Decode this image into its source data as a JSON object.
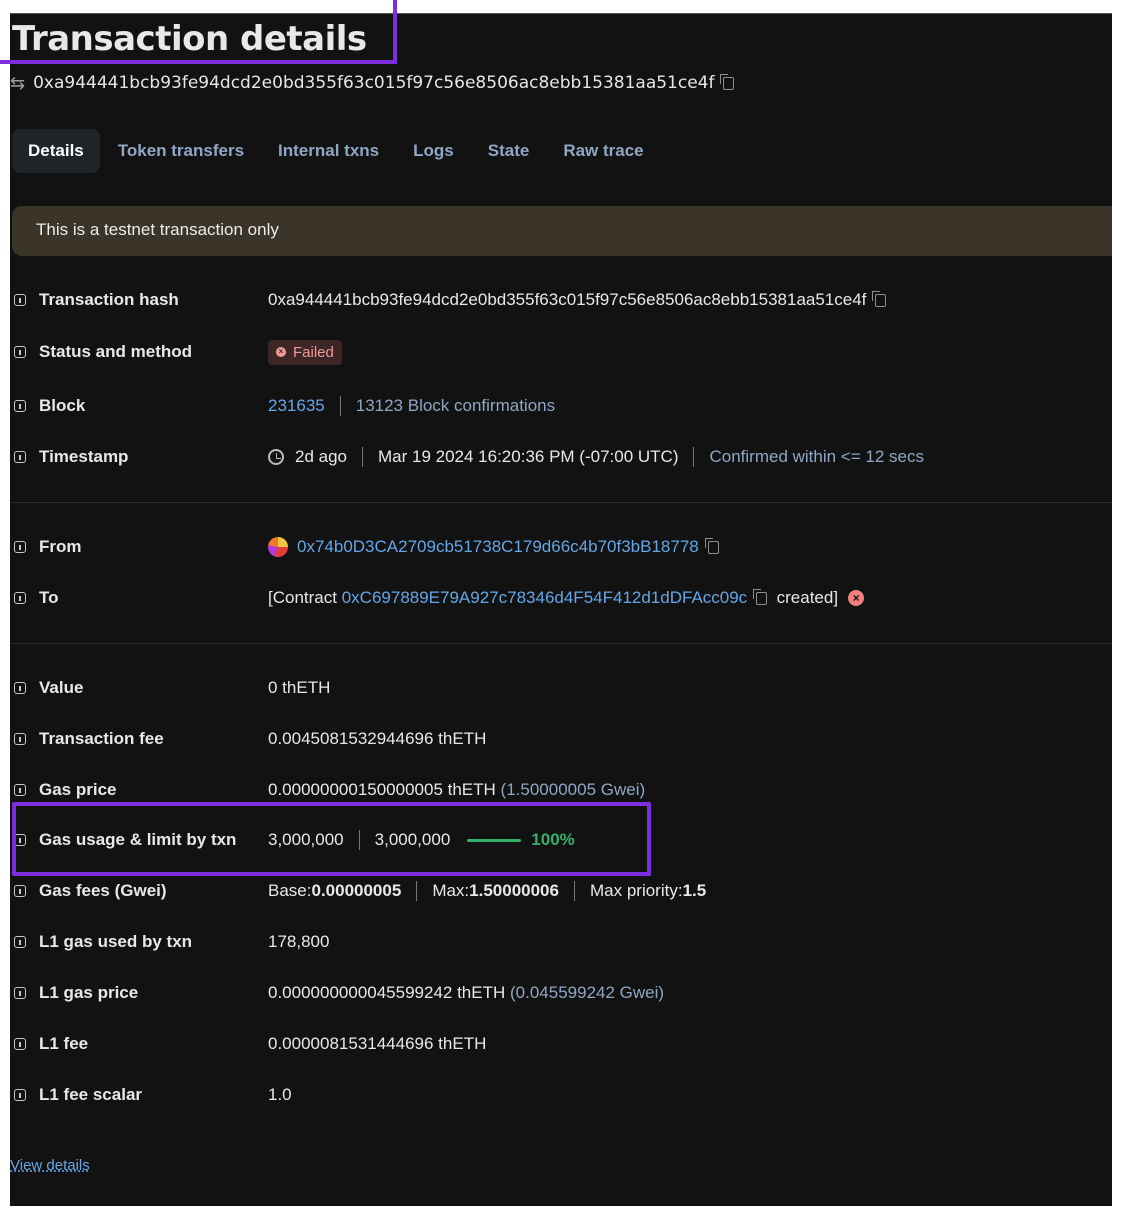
{
  "page": {
    "title": "Transaction details"
  },
  "hash_line": {
    "hash": "0xa944441bcb93fe94dcd2e0bd355f63c015f97c56e8506ac8ebb15381aa51ce4f"
  },
  "tabs": [
    {
      "label": "Details"
    },
    {
      "label": "Token transfers"
    },
    {
      "label": "Internal txns"
    },
    {
      "label": "Logs"
    },
    {
      "label": "State"
    },
    {
      "label": "Raw trace"
    }
  ],
  "alert": {
    "text": "This is a testnet transaction only"
  },
  "labels": {
    "tx_hash": "Transaction hash",
    "status": "Status and method",
    "block": "Block",
    "timestamp": "Timestamp",
    "from": "From",
    "to": "To",
    "value": "Value",
    "fee": "Transaction fee",
    "gas_price": "Gas price",
    "gas_usage": "Gas usage & limit by txn",
    "gas_fees": "Gas fees (Gwei)",
    "l1_gas_used": "L1 gas used by txn",
    "l1_gas_price": "L1 gas price",
    "l1_fee": "L1 fee",
    "l1_fee_scalar": "L1 fee scalar"
  },
  "values": {
    "tx_hash": "0xa944441bcb93fe94dcd2e0bd355f63c015f97c56e8506ac8ebb15381aa51ce4f",
    "status": "Failed",
    "block_number": "231635",
    "block_confirmations": "13123 Block confirmations",
    "time_ago": "2d ago",
    "time_full": "Mar 19 2024 16:20:36 PM (-07:00 UTC)",
    "confirmed_within": "Confirmed within <= 12 secs",
    "from_address": "0x74b0D3CA2709cb51738C179d66c4b70f3bB18778",
    "to_prefix": "[Contract",
    "to_address": "0xC697889E79A927c78346d4F54F412d1dDFAcc09c",
    "to_suffix": "created]",
    "value": "0 thETH",
    "fee": "0.0045081532944696 thETH",
    "gas_price_eth": "0.00000000150000005 thETH",
    "gas_price_gwei": "(1.50000005 Gwei)",
    "gas_used": "3,000,000",
    "gas_limit": "3,000,000",
    "gas_pct": "100%",
    "gas_fee_base_label": "Base: ",
    "gas_fee_base": "0.00000005",
    "gas_fee_max_label": "Max: ",
    "gas_fee_max": "1.50000006",
    "gas_fee_priority_label": "Max priority: ",
    "gas_fee_priority": "1.5",
    "l1_gas_used": "178,800",
    "l1_gas_price_eth": "0.000000000045599242 thETH",
    "l1_gas_price_gwei": "(0.045599242 Gwei)",
    "l1_fee": "0.0000081531444696 thETH",
    "l1_fee_scalar": "1.0"
  },
  "footer": {
    "view_details": "View details"
  },
  "colors": {
    "accent_highlight": "#7c2fe0",
    "link": "#63a7e8",
    "success": "#35b06b",
    "failed": "#f09a9a"
  },
  "icons": [
    "swap-arrows-icon",
    "copy-icon",
    "info-icon",
    "clock-icon",
    "failed-x-icon",
    "error-circle-icon"
  ]
}
